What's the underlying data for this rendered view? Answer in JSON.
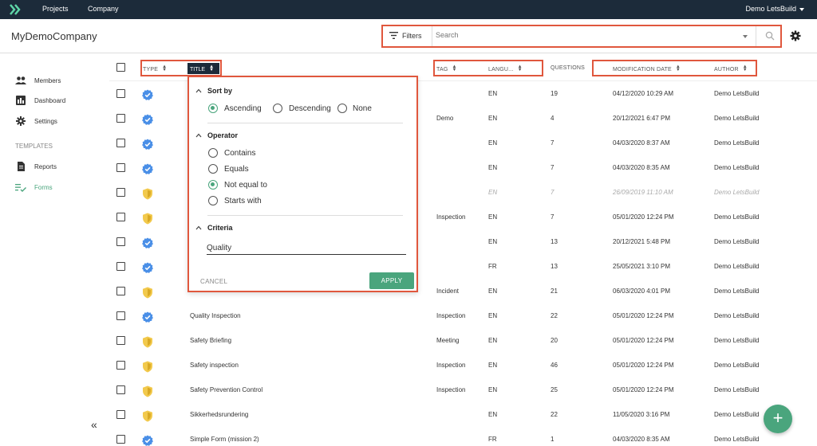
{
  "nav": {
    "links": [
      "Projects",
      "Company"
    ],
    "user": "Demo LetsBuild"
  },
  "header": {
    "company": "MyDemoCompany",
    "filters_label": "Filters",
    "search_placeholder": "Search"
  },
  "sidebar": {
    "members": "Members",
    "dashboard": "Dashboard",
    "settings": "Settings",
    "templates_section": "TEMPLATES",
    "reports": "Reports",
    "forms": "Forms",
    "collapse": "«"
  },
  "table": {
    "headers": {
      "type": "TYPE",
      "title": "TITLE",
      "tag": "TAG",
      "language": "LANGU...",
      "questions": "QUESTIONS",
      "modification_date": "MODIFICATION DATE",
      "author": "AUTHOR"
    },
    "rows": [
      {
        "type": "verified",
        "title": "",
        "tag": "",
        "lang": "EN",
        "questions": "19",
        "date": "04/12/2020 10:29 AM",
        "author": "Demo LetsBuild",
        "muted": false
      },
      {
        "type": "verified",
        "title": "",
        "tag": "Demo",
        "lang": "EN",
        "questions": "4",
        "date": "20/12/2021 6:47 PM",
        "author": "Demo LetsBuild",
        "muted": false
      },
      {
        "type": "verified",
        "title": "",
        "tag": "",
        "lang": "EN",
        "questions": "7",
        "date": "04/03/2020 8:37 AM",
        "author": "Demo LetsBuild",
        "muted": false
      },
      {
        "type": "verified",
        "title": "",
        "tag": "",
        "lang": "EN",
        "questions": "7",
        "date": "04/03/2020 8:35 AM",
        "author": "Demo LetsBuild",
        "muted": false
      },
      {
        "type": "shield",
        "title": "",
        "tag": "",
        "lang": "EN",
        "questions": "7",
        "date": "26/09/2019 11:10 AM",
        "author": "Demo LetsBuild",
        "muted": true
      },
      {
        "type": "shield",
        "title": "",
        "tag": "Inspection",
        "lang": "EN",
        "questions": "7",
        "date": "05/01/2020 12:24 PM",
        "author": "Demo LetsBuild",
        "muted": false
      },
      {
        "type": "verified",
        "title": "",
        "tag": "",
        "lang": "EN",
        "questions": "13",
        "date": "20/12/2021 5:48 PM",
        "author": "Demo LetsBuild",
        "muted": false
      },
      {
        "type": "verified",
        "title": "",
        "tag": "",
        "lang": "FR",
        "questions": "13",
        "date": "25/05/2021 3:10 PM",
        "author": "Demo LetsBuild",
        "muted": false
      },
      {
        "type": "shield",
        "title": "",
        "tag": "Incident",
        "lang": "EN",
        "questions": "21",
        "date": "06/03/2020 4:01 PM",
        "author": "Demo LetsBuild",
        "muted": false
      },
      {
        "type": "verified",
        "title": "Quality Inspection",
        "tag": "Inspection",
        "lang": "EN",
        "questions": "22",
        "date": "05/01/2020 12:24 PM",
        "author": "Demo LetsBuild",
        "muted": false
      },
      {
        "type": "shield",
        "title": "Safety Briefing",
        "tag": "Meeting",
        "lang": "EN",
        "questions": "20",
        "date": "05/01/2020 12:24 PM",
        "author": "Demo LetsBuild",
        "muted": false
      },
      {
        "type": "shield",
        "title": "Safety inspection",
        "tag": "Inspection",
        "lang": "EN",
        "questions": "46",
        "date": "05/01/2020 12:24 PM",
        "author": "Demo LetsBuild",
        "muted": false
      },
      {
        "type": "shield",
        "title": "Safety Prevention Control",
        "tag": "Inspection",
        "lang": "EN",
        "questions": "25",
        "date": "05/01/2020 12:24 PM",
        "author": "Demo LetsBuild",
        "muted": false
      },
      {
        "type": "shield",
        "title": "Sikkerhedsrundering",
        "tag": "",
        "lang": "EN",
        "questions": "22",
        "date": "11/05/2020 3:16 PM",
        "author": "Demo LetsBuild",
        "muted": false
      },
      {
        "type": "verified",
        "title": "Simple Form (mission 2)",
        "tag": "",
        "lang": "FR",
        "questions": "1",
        "date": "04/03/2020 8:35 AM",
        "author": "Demo LetsBuild",
        "muted": false
      }
    ]
  },
  "panel": {
    "sort_title": "Sort by",
    "sort_options": [
      "Ascending",
      "Descending",
      "None"
    ],
    "sort_selected": 0,
    "operator_title": "Operator",
    "operator_options": [
      "Contains",
      "Equals",
      "Not equal to",
      "Starts with"
    ],
    "operator_selected": 2,
    "criteria_title": "Criteria",
    "criteria_value": "Quality",
    "cancel_label": "CANCEL",
    "apply_label": "APPLY"
  },
  "fab_label": "+",
  "colors": {
    "nav_bg": "#1c2b3a",
    "accent_green": "#4aa57d",
    "highlight": "#e0573d",
    "verified_blue": "#4a8fe7",
    "shield_yellow": "#f2c94c"
  }
}
